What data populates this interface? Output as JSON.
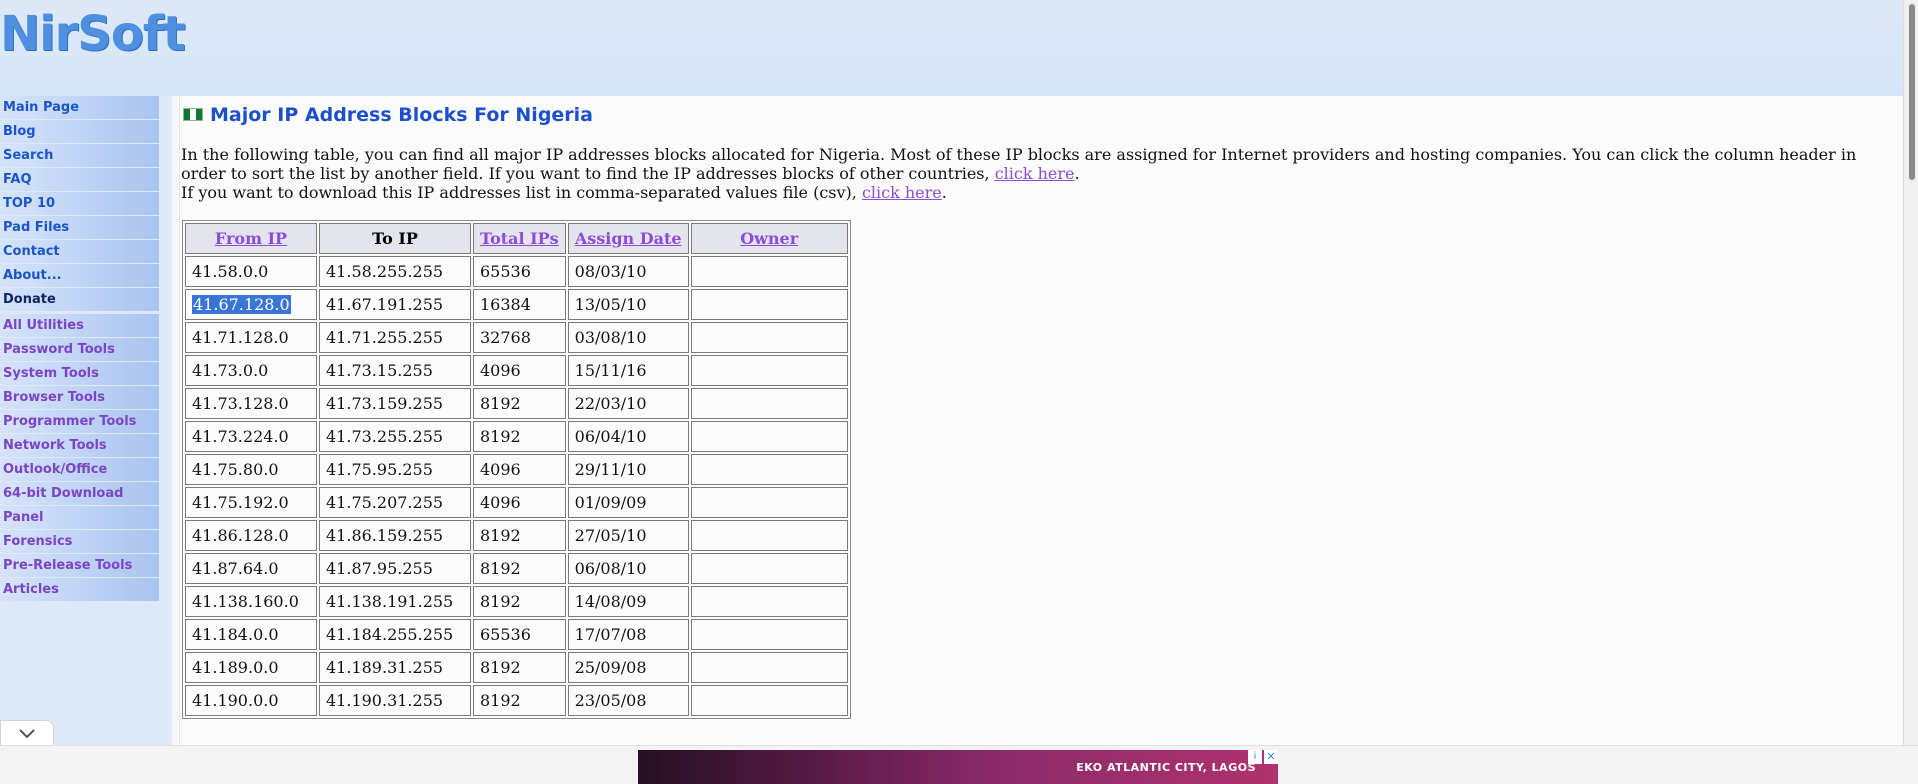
{
  "header": {
    "logo": "NirSoft"
  },
  "sidebar": {
    "items": [
      {
        "label": "Main Page",
        "style": "blue"
      },
      {
        "label": "Blog",
        "style": "blue"
      },
      {
        "label": "Search",
        "style": "blue"
      },
      {
        "label": "FAQ",
        "style": "blue"
      },
      {
        "label": "TOP 10",
        "style": "blue"
      },
      {
        "label": "Pad Files",
        "style": "blue"
      },
      {
        "label": "Contact",
        "style": "blue"
      },
      {
        "label": "About...",
        "style": "blue"
      },
      {
        "label": "Donate",
        "style": "dark"
      },
      {
        "label": "All Utilities",
        "style": "purple"
      },
      {
        "label": "Password Tools",
        "style": "purple"
      },
      {
        "label": "System Tools",
        "style": "purple"
      },
      {
        "label": "Browser Tools",
        "style": "purple"
      },
      {
        "label": "Programmer Tools",
        "style": "purple"
      },
      {
        "label": "Network Tools",
        "style": "purple"
      },
      {
        "label": "Outlook/Office",
        "style": "purple"
      },
      {
        "label": "64-bit Download",
        "style": "purple"
      },
      {
        "label": "Panel",
        "style": "purple"
      },
      {
        "label": "Forensics",
        "style": "purple"
      },
      {
        "label": "Pre-Release Tools",
        "style": "purple"
      },
      {
        "label": "Articles",
        "style": "purple"
      }
    ]
  },
  "main": {
    "flag_colors": [
      "#0a7a2f",
      "#ffffff",
      "#0a7a2f"
    ],
    "title": "Major IP Address Blocks For Nigeria",
    "intro_line1": "In the following table, you can find all major IP addresses blocks allocated for Nigeria. Most of these IP blocks are assigned for Internet providers and hosting companies. You can click the column header in order to sort the list by another field. If you want to find the IP addresses blocks of other countries, ",
    "intro_link1": "click here",
    "intro_after1": ".",
    "intro_line2": "If you want to download this IP addresses list in comma-separated values file (csv), ",
    "intro_link2": "click here",
    "intro_after2": ".",
    "table": {
      "columns": [
        {
          "label": "From IP",
          "link": true
        },
        {
          "label": "To IP",
          "link": false
        },
        {
          "label": "Total IPs",
          "link": true
        },
        {
          "label": "Assign Date",
          "link": true
        },
        {
          "label": "Owner",
          "link": true
        }
      ],
      "selected_text": "41.67.128.0",
      "rows": [
        [
          "41.58.0.0",
          "41.58.255.255",
          "65536",
          "08/03/10",
          ""
        ],
        [
          "41.67.128.0",
          "41.67.191.255",
          "16384",
          "13/05/10",
          ""
        ],
        [
          "41.71.128.0",
          "41.71.255.255",
          "32768",
          "03/08/10",
          ""
        ],
        [
          "41.73.0.0",
          "41.73.15.255",
          "4096",
          "15/11/16",
          ""
        ],
        [
          "41.73.128.0",
          "41.73.159.255",
          "8192",
          "22/03/10",
          ""
        ],
        [
          "41.73.224.0",
          "41.73.255.255",
          "8192",
          "06/04/10",
          ""
        ],
        [
          "41.75.80.0",
          "41.75.95.255",
          "4096",
          "29/11/10",
          ""
        ],
        [
          "41.75.192.0",
          "41.75.207.255",
          "4096",
          "01/09/09",
          ""
        ],
        [
          "41.86.128.0",
          "41.86.159.255",
          "8192",
          "27/05/10",
          ""
        ],
        [
          "41.87.64.0",
          "41.87.95.255",
          "8192",
          "06/08/10",
          ""
        ],
        [
          "41.138.160.0",
          "41.138.191.255",
          "8192",
          "14/08/09",
          ""
        ],
        [
          "41.184.0.0",
          "41.184.255.255",
          "65536",
          "17/07/08",
          ""
        ],
        [
          "41.189.0.0",
          "41.189.31.255",
          "8192",
          "25/09/08",
          ""
        ],
        [
          "41.190.0.0",
          "41.190.31.255",
          "8192",
          "23/05/08",
          ""
        ]
      ]
    }
  },
  "ad": {
    "text": "EKO ATLANTIC CITY, LAGOS",
    "info_icon": "i",
    "close_icon": "✕"
  },
  "icons": {
    "collapse": "chevron-down-icon",
    "flag": "nigeria-flag-icon"
  }
}
